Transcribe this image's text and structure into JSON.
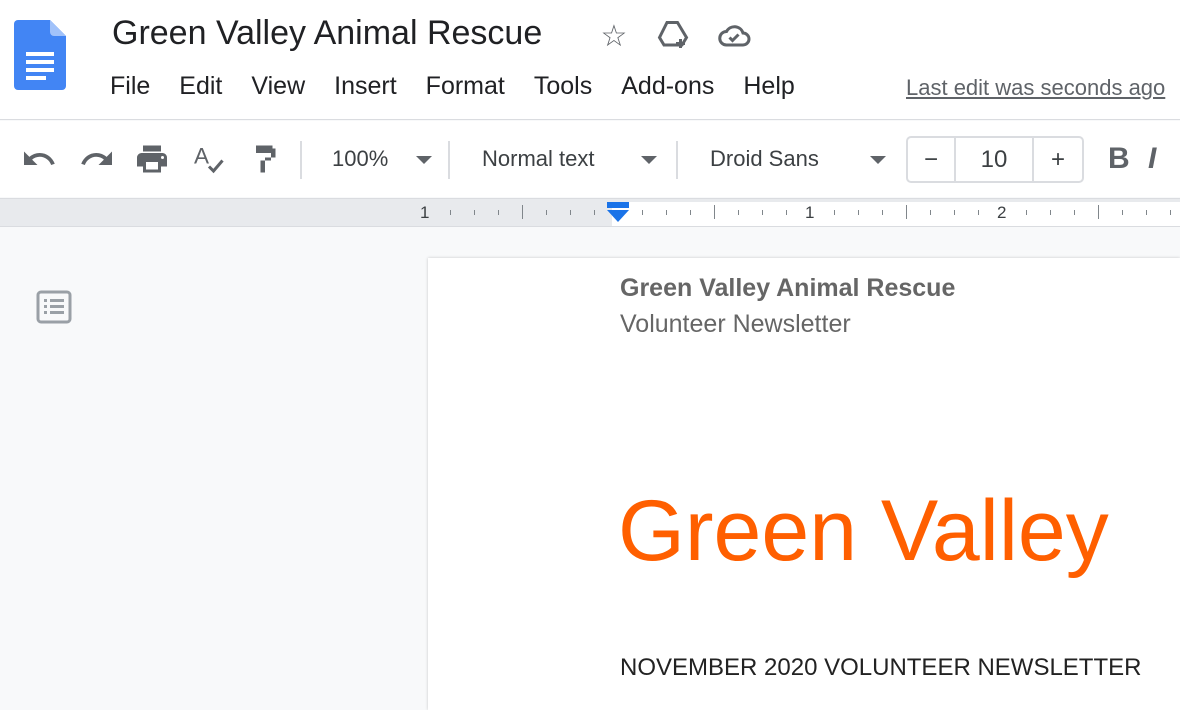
{
  "document": {
    "title": "Green Valley Animal Rescue"
  },
  "menu": [
    "File",
    "Edit",
    "View",
    "Insert",
    "Format",
    "Tools",
    "Add-ons",
    "Help"
  ],
  "last_edit": "Last edit was seconds ago",
  "toolbar": {
    "zoom": "100%",
    "style": "Normal text",
    "font": "Droid Sans",
    "font_size": "10",
    "minus": "−",
    "plus": "+",
    "bold": "B",
    "italic": "I"
  },
  "ruler": {
    "labels": [
      "1",
      "1",
      "2"
    ]
  },
  "page": {
    "header_title": "Green Valley Animal Rescue",
    "header_subtitle": "Volunteer Newsletter",
    "big_title": "Green Valley",
    "subtitle": "NOVEMBER 2020 VOLUNTEER NEWSLETTER"
  },
  "colors": {
    "accent": "#1a73e8",
    "title_orange": "#ff5f00"
  }
}
